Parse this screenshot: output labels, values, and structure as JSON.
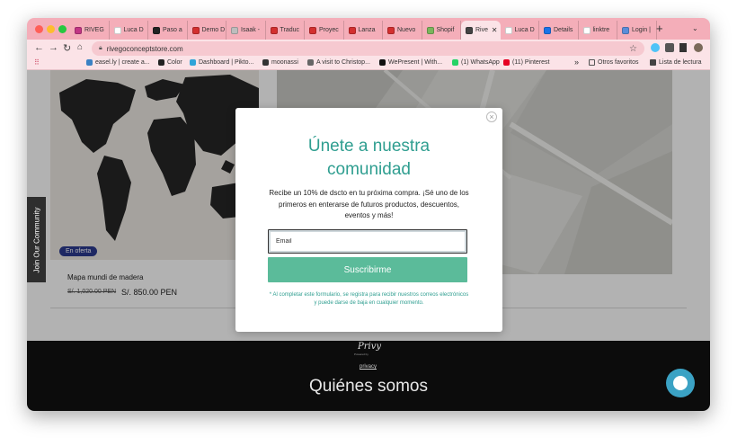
{
  "browser": {
    "tabs": [
      {
        "label": "RIVEG",
        "color": "#c13584"
      },
      {
        "label": "Luca D",
        "color": "#ffffff"
      },
      {
        "label": "Paso a",
        "color": "#222222"
      },
      {
        "label": "Demo D",
        "color": "#d32f2f"
      },
      {
        "label": "Isaak -",
        "color": "#bdbdbd"
      },
      {
        "label": "Traduc",
        "color": "#d32f2f"
      },
      {
        "label": "Proyec",
        "color": "#d32f2f"
      },
      {
        "label": "Lanza",
        "color": "#d32f2f"
      },
      {
        "label": "Nuevo",
        "color": "#d32f2f"
      },
      {
        "label": "Shopif",
        "color": "#7ab55c"
      },
      {
        "label": "Rive",
        "color": "#444444"
      },
      {
        "label": "Luca D",
        "color": "#ffffff"
      },
      {
        "label": "Details",
        "color": "#1a73e8"
      },
      {
        "label": "linktre",
        "color": "#ffffff"
      },
      {
        "label": "Login |",
        "color": "#5b8dd9"
      }
    ],
    "new_tab": "+",
    "url": "rivegoconceptstore.com",
    "bookmarks": [
      {
        "label": "easel.ly | create a...",
        "color": "#3b82c4"
      },
      {
        "label": "Color",
        "color": "#222222"
      },
      {
        "label": "Dashboard | Pikto...",
        "color": "#2fa3d8"
      },
      {
        "label": "moonassi",
        "color": "#333333"
      },
      {
        "label": "A visit to Christop...",
        "color": "#666666"
      },
      {
        "label": "WePresent | With...",
        "color": "#111111"
      },
      {
        "label": "(1) WhatsApp",
        "color": "#25d366"
      },
      {
        "label": "(11) Pinterest",
        "color": "#e60023"
      }
    ],
    "bookmarks_more": "»",
    "other_bookmarks": "Otros favoritos",
    "reading_list": "Lista de lectura"
  },
  "page": {
    "side_tab": "Join Our Community",
    "product": {
      "badge": "En oferta",
      "name": "Mapa mundi de madera",
      "old_price": "S/. 1,020.00 PEN",
      "new_price": "S/. 850.00 PEN"
    },
    "footer": {
      "brand": "Privy",
      "powered": "Powered by",
      "privacy": "privacy",
      "about": "Quiénes somos"
    }
  },
  "modal": {
    "close": "×",
    "title_line1": "Únete a nuestra",
    "title_line2": "comunidad",
    "description": "Recibe un 10% de dscto en tu próxima compra. ¡Sé uno de los primeros en enterarse de futuros productos, descuentos, eventos y más!",
    "email_placeholder": "Email",
    "subscribe_label": "Suscribirme",
    "legal": "* Al completar este formulario, se registra para recibir nuestros correos electrónicos y puede darse de baja en cualquier momento."
  },
  "colors": {
    "accent_teal": "#2f9e90",
    "button_green": "#5bbb9a",
    "badge_blue": "#2b3a8f",
    "tab_strip_pink": "#f4aeb9",
    "chat_blue": "#3ba2c4"
  }
}
